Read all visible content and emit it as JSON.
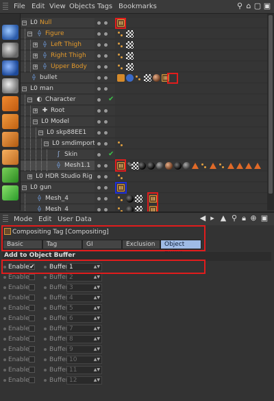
{
  "menubar": {
    "items": [
      "File",
      "Edit",
      "View",
      "Objects",
      "Tags",
      "Bookmarks"
    ]
  },
  "objects": [
    {
      "name": "Null",
      "color": "orange"
    },
    {
      "name": "Figure",
      "color": "orange"
    },
    {
      "name": "Left Thigh",
      "color": "orange"
    },
    {
      "name": "Right Thigh",
      "color": "orange"
    },
    {
      "name": "Upper Body",
      "color": "orange"
    },
    {
      "name": "bullet",
      "color": "white"
    },
    {
      "name": "man",
      "color": "white"
    },
    {
      "name": "Character",
      "color": "white"
    },
    {
      "name": "Root",
      "color": "white"
    },
    {
      "name": "Model",
      "color": "white"
    },
    {
      "name": "skp88EE1",
      "color": "white"
    },
    {
      "name": "smdimport1",
      "color": "white"
    },
    {
      "name": "Skin",
      "color": "white"
    },
    {
      "name": "Mesh1.1",
      "color": "white"
    },
    {
      "name": "HDR Studio Rig",
      "color": "white"
    },
    {
      "name": "gun",
      "color": "white"
    },
    {
      "name": "Mesh_4",
      "color": "white"
    },
    {
      "name": "Mesh_4",
      "color": "white"
    }
  ],
  "attr_menubar": {
    "items": [
      "Mode",
      "Edit",
      "User Data"
    ]
  },
  "tag_title": "Compositing Tag [Compositing]",
  "tabs": [
    {
      "label": "Basic",
      "active": false
    },
    {
      "label": "Tag",
      "active": false
    },
    {
      "label": "GI",
      "active": false
    },
    {
      "label": "Exclusion",
      "active": false
    },
    {
      "label": "Object Buffer",
      "active": true
    }
  ],
  "section_title": "Add to Object Buffer",
  "buffers": [
    {
      "enable_label": "Enable",
      "buffer_label": "Buffer",
      "value": "1",
      "enabled": true
    },
    {
      "enable_label": "Enable",
      "buffer_label": "Buffer",
      "value": "2",
      "enabled": false
    },
    {
      "enable_label": "Enable",
      "buffer_label": "Buffer",
      "value": "3",
      "enabled": false
    },
    {
      "enable_label": "Enable",
      "buffer_label": "Buffer",
      "value": "4",
      "enabled": false
    },
    {
      "enable_label": "Enable",
      "buffer_label": "Buffer",
      "value": "5",
      "enabled": false
    },
    {
      "enable_label": "Enable",
      "buffer_label": "Buffer",
      "value": "6",
      "enabled": false
    },
    {
      "enable_label": "Enable",
      "buffer_label": "Buffer",
      "value": "7",
      "enabled": false
    },
    {
      "enable_label": "Enable",
      "buffer_label": "Buffer",
      "value": "8",
      "enabled": false
    },
    {
      "enable_label": "Enable",
      "buffer_label": "Buffer",
      "value": "9",
      "enabled": false
    },
    {
      "enable_label": "Enable",
      "buffer_label": "Buffer",
      "value": "10",
      "enabled": false
    },
    {
      "enable_label": "Enable",
      "buffer_label": "Buffer",
      "value": "11",
      "enabled": false
    },
    {
      "enable_label": "Enable",
      "buffer_label": "Buffer",
      "value": "12",
      "enabled": false
    }
  ],
  "check_glyph": "✔",
  "colors": {
    "orange_label": "#e49a2b",
    "highlight_red": "#e21c1c",
    "highlight_blue": "#1e2fd8",
    "active_tab": "#9fbbe6"
  }
}
